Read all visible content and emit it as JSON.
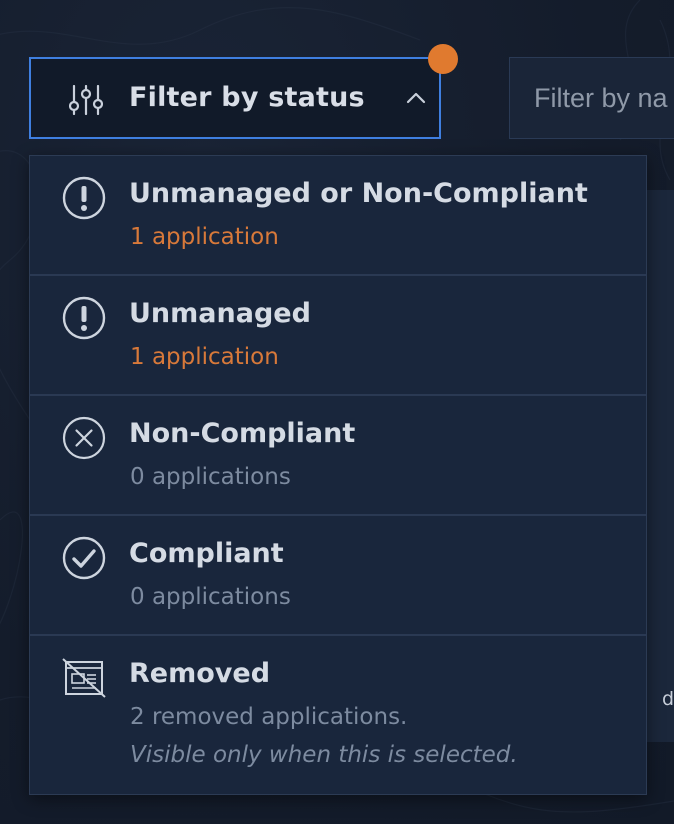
{
  "filter": {
    "label": "Filter by status",
    "icon": "sliders-icon",
    "expanded": true,
    "accent_color": "#3f7fe0",
    "badge_color": "#e07a2f"
  },
  "search": {
    "placeholder": "Filter by na"
  },
  "background": {
    "partial_text": "d"
  },
  "menu": {
    "items": [
      {
        "title": "Unmanaged or Non-Compliant",
        "subtitle": "1 application",
        "icon": "exclamation-circle-icon",
        "tone": "warn"
      },
      {
        "title": "Unmanaged",
        "subtitle": "1 application",
        "icon": "exclamation-circle-icon",
        "tone": "warn"
      },
      {
        "title": "Non-Compliant",
        "subtitle": "0 applications",
        "icon": "x-circle-icon",
        "tone": "muted"
      },
      {
        "title": "Compliant",
        "subtitle": "0 applications",
        "icon": "check-circle-icon",
        "tone": "muted"
      },
      {
        "title": "Removed",
        "subtitle": "2 removed applications.",
        "note": "Visible only when this is selected.",
        "icon": "removed-window-icon",
        "tone": "muted"
      }
    ]
  },
  "colors": {
    "warn": "#d8793a",
    "muted": "#7d8ba0",
    "text": "#d5dbe4"
  }
}
